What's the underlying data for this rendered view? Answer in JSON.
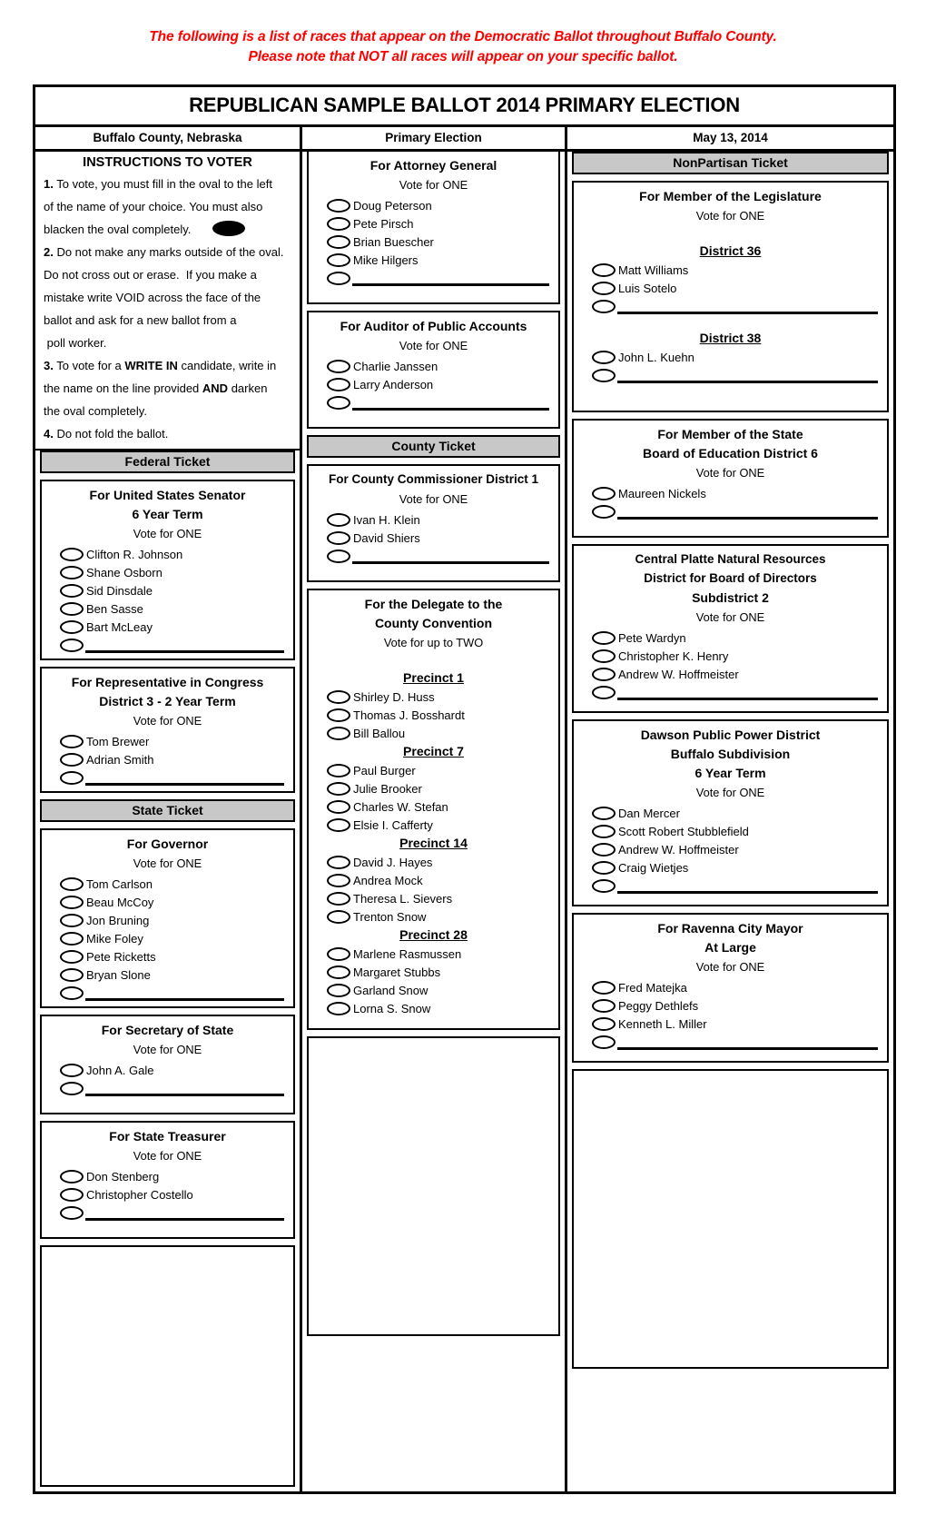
{
  "notice": {
    "line1": "The following is a list of races that appear on the Democratic Ballot throughout Buffalo County.",
    "line2": "Please note that NOT all races will appear on your specific ballot."
  },
  "ballot": {
    "title": "REPUBLICAN SAMPLE BALLOT 2014 PRIMARY ELECTION",
    "header": {
      "county": "Buffalo County, Nebraska",
      "election": "Primary Election",
      "date": "May 13, 2014"
    }
  },
  "instructions": {
    "heading": "INSTRUCTIONS TO VOTER",
    "lines": [
      "1. To vote, you must fill in the oval to the left",
      "of the name of your choice. You must also",
      "blacken the oval completely.",
      "2. Do not make any marks outside of the oval.",
      "Do not cross out or erase.  If you make a",
      "mistake write VOID across the face of the",
      "ballot and ask for a new ballot from a",
      " poll worker.",
      "3. To vote for a WRITE IN candidate, write in",
      "the name on the line provided AND darken",
      "the oval completely.",
      "4. Do not fold the ballot."
    ]
  },
  "bands": {
    "federal": "Federal Ticket",
    "state": "State Ticket",
    "county": "County Ticket",
    "nonpartisan": "NonPartisan Ticket"
  },
  "labels": {
    "vote_one": "Vote for ONE",
    "vote_two": "Vote for up to TWO"
  },
  "contests": {
    "us_senator": {
      "title1": "For United States Senator",
      "title2": "6 Year Term",
      "vote_for": "Vote for ONE",
      "candidates": [
        "Clifton R. Johnson",
        "Shane Osborn",
        "Sid Dinsdale",
        "Ben Sasse",
        "Bart McLeay"
      ]
    },
    "us_rep": {
      "title1": "For Representative in Congress",
      "title2": "District 3 - 2 Year Term",
      "vote_for": "Vote for ONE",
      "candidates": [
        "Tom Brewer",
        "Adrian Smith"
      ]
    },
    "governor": {
      "title1": "For Governor",
      "vote_for": "Vote for ONE",
      "candidates": [
        "Tom Carlson",
        "Beau McCoy",
        "Jon Bruning",
        "Mike Foley",
        "Pete Ricketts",
        "Bryan Slone"
      ]
    },
    "secretary_of_state": {
      "title1": "For Secretary of State",
      "vote_for": "Vote for ONE",
      "candidates": [
        "John A. Gale"
      ]
    },
    "state_treasurer": {
      "title1": "For State Treasurer",
      "vote_for": "Vote for ONE",
      "candidates": [
        "Don Stenberg",
        "Christopher Costello"
      ]
    },
    "attorney_general": {
      "title1": "For Attorney General",
      "vote_for": "Vote for ONE",
      "candidates": [
        "Doug Peterson",
        "Pete Pirsch",
        "Brian Buescher",
        "Mike Hilgers"
      ]
    },
    "auditor": {
      "title1": "For Auditor of Public Accounts",
      "vote_for": "Vote for ONE",
      "candidates": [
        "Charlie Janssen",
        "Larry Anderson"
      ]
    },
    "county_commissioner": {
      "title1": "For County Commissioner District 1",
      "vote_for": "Vote for ONE",
      "candidates": [
        "Ivan H. Klein",
        "David Shiers"
      ]
    },
    "delegate": {
      "title1": "For the Delegate to the",
      "title2": "County Convention",
      "vote_for": "Vote for up to TWO",
      "precincts": [
        {
          "name": "Precinct 1",
          "candidates": [
            "Shirley D. Huss",
            "Thomas J. Bosshardt",
            "Bill Ballou"
          ]
        },
        {
          "name": "Precinct 7",
          "candidates": [
            "Paul Burger",
            "Julie Brooker",
            "Charles W. Stefan",
            "Elsie I. Cafferty"
          ]
        },
        {
          "name": "Precinct 14",
          "candidates": [
            "David J. Hayes",
            "Andrea Mock",
            "Theresa L. Sievers",
            "Trenton Snow"
          ]
        },
        {
          "name": "Precinct 28",
          "candidates": [
            "Marlene Rasmussen",
            "Margaret Stubbs",
            "Garland Snow",
            "Lorna S. Snow"
          ]
        }
      ]
    },
    "legislature": {
      "title1": "For Member of the Legislature",
      "vote_for": "Vote for ONE",
      "districts": [
        {
          "name": "District 36",
          "candidates": [
            "Matt Williams",
            "Luis Sotelo"
          ]
        },
        {
          "name": "District 38",
          "candidates": [
            "John L. Kuehn"
          ]
        }
      ]
    },
    "state_board_education": {
      "title1": "For Member of the State",
      "title2": "Board of Education District 6",
      "vote_for": "Vote for ONE",
      "candidates": [
        "Maureen Nickels"
      ]
    },
    "central_platte": {
      "title1": "Central Platte Natural Resources",
      "title2": "District for Board of Directors",
      "title3": "Subdistrict 2",
      "vote_for": "Vote for ONE",
      "candidates": [
        "Pete Wardyn",
        "Christopher K. Henry",
        "Andrew W. Hoffmeister"
      ]
    },
    "dawson_power": {
      "title1": "Dawson Public Power District",
      "title2": "Buffalo Subdivision",
      "title3": "6 Year Term",
      "vote_for": "Vote for ONE",
      "candidates": [
        "Dan Mercer",
        "Scott Robert Stubblefield",
        "Andrew W. Hoffmeister",
        "Craig Wietjes"
      ]
    },
    "ravenna_mayor": {
      "title1": "For Ravenna City Mayor",
      "title2": "At Large",
      "vote_for": "Vote for ONE",
      "candidates": [
        "Fred Matejka",
        "Peggy Dethlefs",
        "Kenneth L. Miller"
      ]
    }
  },
  "colors": {
    "notice": "#ff0000",
    "band": "#c8c8c8",
    "ink": "#000000"
  }
}
